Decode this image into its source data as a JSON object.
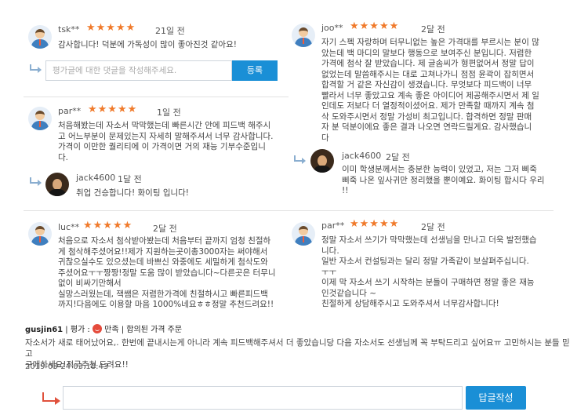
{
  "colors": {
    "accent": "#1a8fd6",
    "star": "#f07a2b",
    "sat": "#e54b3c"
  },
  "left": {
    "r1": {
      "user": "tsk**",
      "stars": "★★★★★",
      "when": "21일 전",
      "text": "감사합니다! 덕분에 가독성이 많이 좋아진것 같아요!",
      "reply_placeholder": "평가글에 대한 댓글을 작성해주세요.",
      "reply_button": "등록"
    },
    "r2": {
      "user": "par**",
      "stars": "★★★★★",
      "when": "1일 전",
      "text": "처음해봤는데 자소서 막막했는데 빠른시간 안에 피드백 해주시\n고 어느부분이 문제있는지 자세히 말해주셔서 너무 감사합니다.\n가격이 이만한 퀄리티에 이 가격이면 거의 재능 기부수준입니\n다.",
      "reply": {
        "user": "jack4600",
        "when": "1달 전",
        "text": "취업 건승합니다! 화이팅 입니다!"
      }
    },
    "r3": {
      "user": "luc**",
      "stars": "★★★★★",
      "when": "2달 전",
      "text": "처음으로 자소서 첨삭받아봤는데 처음부터 끝까지 엄청 친절하\n게 첨삭해주셨어요!!제가 지원하는곳이총3000자는 써야해서\n귀찮으실수도 있으셨는데 바쁘신 와중에도 세밀하게 첨삭도와\n주셨어요ㅜㅜ짱짱!정말 도움 많이 받았습니다~다른곳은 터무니\n없이 비싸기만해서\n실망스러웠는데, 잭쌤은 저렴한가격에 친절하시고 빠른피드백\n까지!다음에도 이용할 마음 1000%네요ㅎㅎ정말 추천드려요!!"
    }
  },
  "right": {
    "r1": {
      "user": "joo**",
      "stars": "★★★★★",
      "when": "2달 전",
      "text": "자기 스펙 자랑하며 터무니없는 높은 가격대를 부르시는 분이 많\n았는데 백 마디의 말보다 행동으로 보여주신 분입니다. 저렴한\n가격에 첨삭 잘 받았습니다. 제 글솜씨가 형편없어서 정말 답이\n없었는데 말씀해주시는 대로 고쳐나가니 점점 윤곽이 잡히면서\n합격할 거 같은 자신감이 생겼습니다. 무엇보다 피드백이 너무\n빨라서 너무 좋았고요 계속 좋은 아이디어 제공해주시면서 제 일\n인데도 저보다 더 열정적이셨어요. 제가 만족할 때까지 계속 첨\n삭 도와주시면서 정말 가성비 최고입니다. 합격하면 정말 판매\n자 분 덕분이에요 좋은 결과 나오면 연락드릴게요. 감사했습니\n다",
      "reply": {
        "user": "jack4600",
        "when": "2달 전",
        "text": "이미 학생분께서는 충분한 능력이 있었고, 저는 그저 삐죽\n삐죽 나온 잎사귀만 정리했을 뿐이예요. 화이팅 합시다 우리\n!!"
      }
    },
    "r2": {
      "user": "par**",
      "stars": "★★★★★",
      "when": "2달 전",
      "text": "정말 자소서 쓰기가 막막했는데 선생님을 만나고 더욱 발전했습\n니다.\n일반 자소서 컨설팅과는 달리 정말 가족같이 보살펴주십니다.\nㅜㅜ\n이제 막 자소서 쓰기 시작하는 분들이 구매하면 정말 좋은 재능\n인것같습니다 ~\n친절하게 상담해주시고 도와주셔서 너무감사합니다!"
    }
  },
  "bottom": {
    "user": "gusjin61",
    "rating_label": " | 평가 : ",
    "satisfaction": "만족",
    "extra": " | 합의된 가격 주문",
    "text": "자소서가 새로 태어났어요,. 한번에 끝내시는게 아니라 계속 피드백해주셔서 더 좋았습니당 다음 자소서도 선생님께 꼭 부탁드리고 싶어요ㅠ 고민하시는 분들 믿고\n구매하세요!적극추천 드려요!!",
    "date": "2019-03-24 03:18:43",
    "submit_label": "답글작성"
  }
}
